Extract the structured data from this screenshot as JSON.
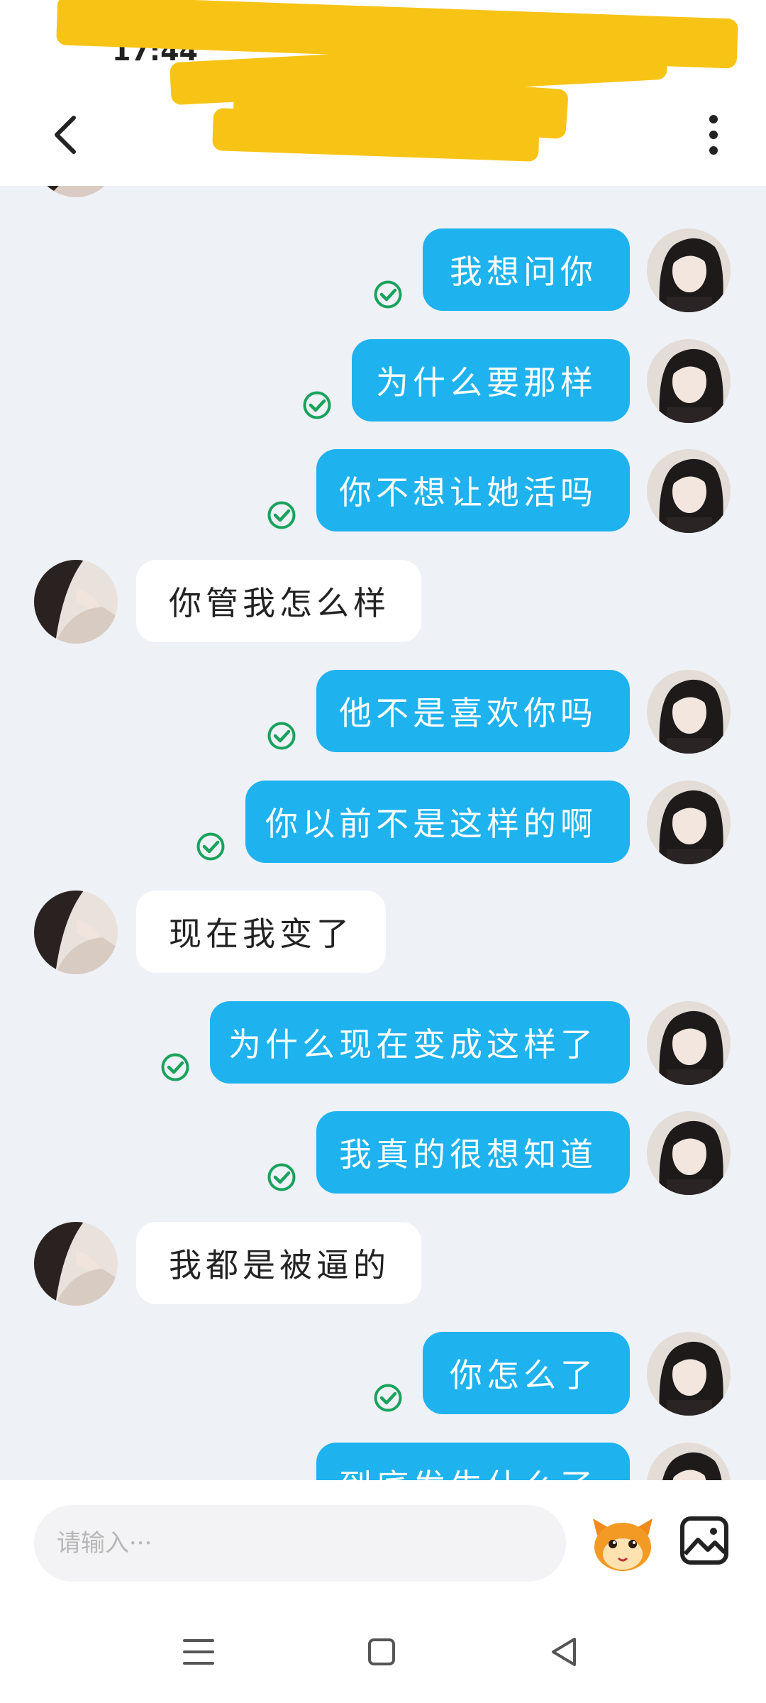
{
  "status": {
    "time": "17:44"
  },
  "header": {
    "title": ""
  },
  "colors": {
    "bubble_me": "#1eb2ee",
    "bubble_other": "#ffffff",
    "check": "#19a25c",
    "background": "#eef1f6"
  },
  "messages": [
    {
      "side": "right",
      "text": "我想问你"
    },
    {
      "side": "right",
      "text": "为什么要那样"
    },
    {
      "side": "right",
      "text": "你不想让她活吗"
    },
    {
      "side": "left",
      "text": "你管我怎么样"
    },
    {
      "side": "right",
      "text": "他不是喜欢你吗"
    },
    {
      "side": "right",
      "text": "你以前不是这样的啊"
    },
    {
      "side": "left",
      "text": "现在我变了"
    },
    {
      "side": "right",
      "text": "为什么现在变成这样了"
    },
    {
      "side": "right",
      "text": "我真的很想知道"
    },
    {
      "side": "left",
      "text": "我都是被逼的"
    },
    {
      "side": "right",
      "text": "你怎么了"
    },
    {
      "side": "right",
      "text": "到底发生什么了"
    }
  ],
  "input": {
    "placeholder": "请输入···",
    "value": ""
  },
  "icons": {
    "back": "back-arrow-icon",
    "more": "more-vertical-icon",
    "emoji": "emoji-mascot-icon",
    "image": "image-icon",
    "read": "read-check-icon",
    "nav_menu": "menu-icon",
    "nav_home": "home-square-icon",
    "nav_back": "back-triangle-icon"
  }
}
